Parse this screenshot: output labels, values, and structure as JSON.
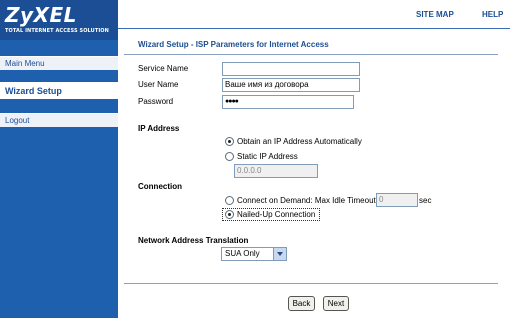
{
  "brand": {
    "logo": "ZyXEL",
    "tagline": "TOTAL INTERNET ACCESS SOLUTION"
  },
  "sidebar": {
    "items": [
      {
        "label": "Main Menu"
      },
      {
        "label": "Wizard Setup"
      },
      {
        "label": "Logout"
      }
    ]
  },
  "topnav": {
    "site_map": "SITE MAP",
    "help": "HELP"
  },
  "page": {
    "title": "Wizard Setup - ISP Parameters for Internet Access"
  },
  "form": {
    "service_name": {
      "label": "Service Name",
      "value": ""
    },
    "user_name": {
      "label": "User Name",
      "value": "Ваше имя из договора"
    },
    "password": {
      "label": "Password",
      "value": "●●●●"
    },
    "ip_address": {
      "heading": "IP Address",
      "option_auto": "Obtain an IP Address Automatically",
      "option_static": "Static IP Address",
      "static_value": "0.0.0.0",
      "selected": "auto"
    },
    "connection": {
      "heading": "Connection",
      "option_demand": "Connect on Demand: Max Idle Timeout",
      "idle_timeout": "0",
      "unit": "sec",
      "option_nailed": "Nailed-Up Connection",
      "selected": "nailed"
    },
    "nat": {
      "heading": "Network Address Translation",
      "selected": "SUA Only"
    }
  },
  "buttons": {
    "back": "Back",
    "next": "Next"
  },
  "colors": {
    "brand_blue": "#1e5fae",
    "title_blue": "#1b4e94"
  }
}
